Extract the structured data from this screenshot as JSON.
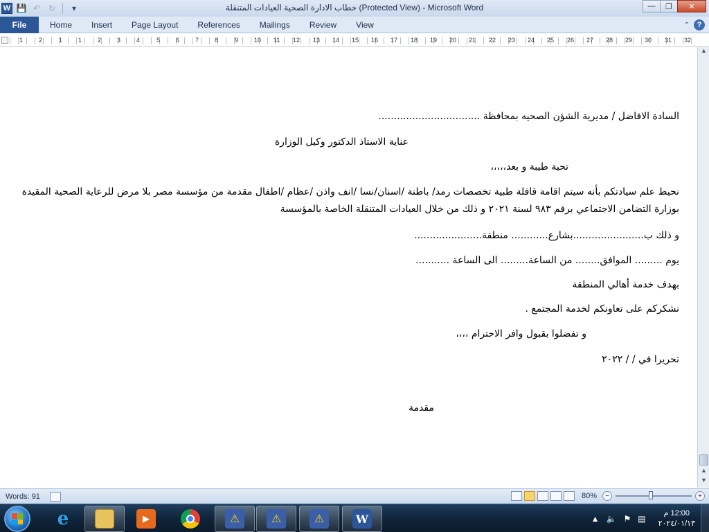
{
  "window": {
    "title": "خطاب الادارة الصحية العيادات المتنقلة (Protected View)  -  Microsoft Word",
    "app_icon": "W"
  },
  "ribbon": {
    "file_label": "File",
    "tabs": [
      "Home",
      "Insert",
      "Page Layout",
      "References",
      "Mailings",
      "Review",
      "View"
    ]
  },
  "ruler": {
    "numbers": [
      "1",
      "2",
      "1",
      "1",
      "2",
      "3",
      "4",
      "5",
      "6",
      "7",
      "8",
      "9",
      "10",
      "11",
      "12",
      "13",
      "14",
      "15",
      "16",
      "17",
      "18",
      "19",
      "20",
      "21",
      "22",
      "23",
      "24",
      "25",
      "26",
      "27",
      "28",
      "29",
      "30",
      "31",
      "32"
    ]
  },
  "document": {
    "line1": "السادة الافاضل / مديرية الشؤن الصحيه بمحافظة .................................",
    "line2": "عناية الاستاذ الدكتور وكيل الوزارة",
    "line3": "تحية طيبة و بعد،،،،،",
    "line4": "نحيط علم سيادتكم بأنه سيتم اقامة قافلة طبية تخصصات رمد/ باطنة /اسنان/نسا /انف واذن /عظام /اطفال مقدمة من مؤسسة مصر بلا مرض للرعاية الصحية المقيدة",
    "line5": "بوزارة التضامن الاجتماعي برقم ٩٨٣ لسنة ٢٠٢١ و ذلك من خلال العيادات المتنقلة الخاصة بالمؤسسة",
    "line6": "و ذلك ب.......................بشارع............ منطقة......................",
    "line7": "يوم ......... الموافق........ من الساعة......... الى الساعة ...........",
    "line8": "بهدف خدمة أهالي المنطقة",
    "line9": "نشكركم على تعاونكم لخدمة المجتمع .",
    "line10": "و تفضلوا بقبول وافر الاحترام ،،،،",
    "line11": "تحريرا في    /   / ٢٠٢٢",
    "line12": "مقدمة"
  },
  "status": {
    "words": "Words: 91",
    "zoom": "80%"
  },
  "taskbar": {
    "clock_time": "12:00 م",
    "clock_date": "٢٠٢٤/٠١/١٣"
  },
  "colors": {
    "file_tab": "#2b5797",
    "title_bar": "#dfe9f5",
    "taskbar": "#10243a"
  }
}
